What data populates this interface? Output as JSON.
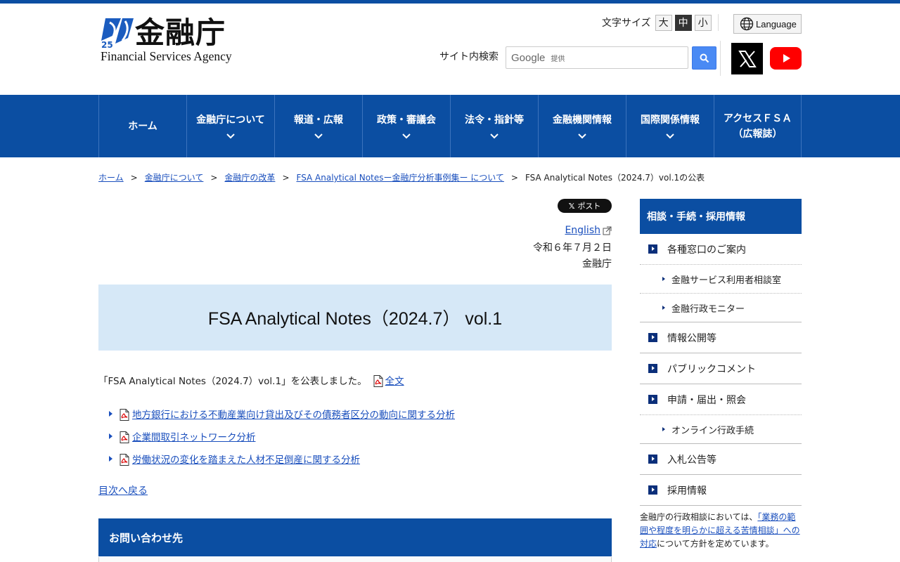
{
  "header": {
    "logo_jp": "金融庁",
    "logo_en": "Financial Services Agency",
    "font_size_label": "文字サイズ",
    "font_sizes": [
      "大",
      "中",
      "小"
    ],
    "font_size_selected": "中",
    "language_label": "Language",
    "search_label": "サイト内検索",
    "search_google": "Google",
    "search_provided": "提供",
    "social": [
      "x-icon",
      "youtube-icon"
    ]
  },
  "nav": {
    "items": [
      {
        "label": "ホーム",
        "line2": ""
      },
      {
        "label": "金融庁について",
        "line2": ""
      },
      {
        "label": "報道・広報",
        "line2": ""
      },
      {
        "label": "政策・審議会",
        "line2": ""
      },
      {
        "label": "法令・指針等",
        "line2": ""
      },
      {
        "label": "金融機関情報",
        "line2": ""
      },
      {
        "label": "国際関係情報",
        "line2": ""
      },
      {
        "label": "アクセスＦＳＡ",
        "line2": "（広報誌）"
      }
    ]
  },
  "breadcrumb": {
    "items": [
      "ホーム",
      "金融庁について",
      "金融庁の改革",
      "FSA Analytical Notesー金融庁分析事例集ー について"
    ],
    "current": "FSA Analytical Notes（2024.7）vol.1の公表",
    "separator": ">"
  },
  "main": {
    "post_label": "ポスト",
    "english_link": "English",
    "date": "令和６年７月２日",
    "agency": "金融庁",
    "title": "FSA Analytical Notes（2024.7） vol.1",
    "intro_text": "「FSA Analytical Notes（2024.7）vol.1」を公表しました。",
    "full_text_link": "全文",
    "pdf_links": [
      "地方銀行における不動産業向け貸出及びその債務者区分の動向に関する分析",
      "企業間取引ネットワーク分析",
      "労働状況の変化を踏まえた人材不足倒産に関する分析"
    ],
    "back_link": "目次へ戻る",
    "contact_heading": "お問い合わせ先"
  },
  "sidebar": {
    "heading": "相談・手続・採用情報",
    "items": [
      {
        "label": "各種窓口のご案内"
      },
      {
        "label": "金融サービス利用者相談室"
      },
      {
        "label": "金融行政モニター"
      },
      {
        "label": "情報公開等"
      },
      {
        "label": "パブリックコメント"
      },
      {
        "label": "申請・届出・照会"
      },
      {
        "label": "オンライン行政手続"
      },
      {
        "label": "入札公告等"
      },
      {
        "label": "採用情報"
      }
    ],
    "note_pre": "金融庁の行政相談においては、",
    "note_link": "「業務の範囲や程度を明らかに超える苦情相談」への対応",
    "note_post": "について方針を定めています。"
  },
  "colors": {
    "brand_blue": "#0b4ea2",
    "title_bg": "#d6e8f7",
    "link": "#1a4fbd"
  }
}
